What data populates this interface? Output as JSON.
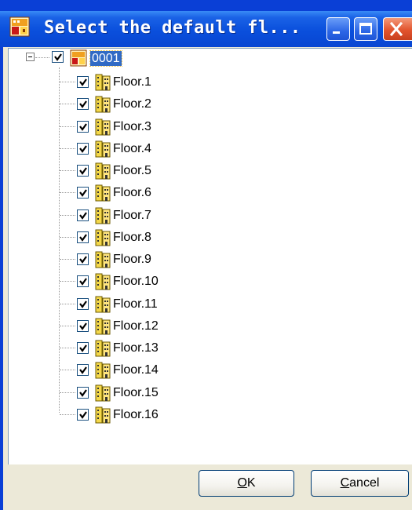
{
  "window": {
    "title": "Select the default fl...",
    "title_icon": "building-card-icon",
    "controls": [
      "minimize-icon",
      "maximize-icon",
      "close-icon"
    ]
  },
  "tree": {
    "root": {
      "label": "0001",
      "checked": true,
      "expanded": true,
      "selected": true,
      "icon": "building-card-icon"
    },
    "children": [
      {
        "label": "Floor.1",
        "checked": true,
        "icon": "floor-building-icon"
      },
      {
        "label": "Floor.2",
        "checked": true,
        "icon": "floor-building-icon"
      },
      {
        "label": "Floor.3",
        "checked": true,
        "icon": "floor-building-icon"
      },
      {
        "label": "Floor.4",
        "checked": true,
        "icon": "floor-building-icon"
      },
      {
        "label": "Floor.5",
        "checked": true,
        "icon": "floor-building-icon"
      },
      {
        "label": "Floor.6",
        "checked": true,
        "icon": "floor-building-icon"
      },
      {
        "label": "Floor.7",
        "checked": true,
        "icon": "floor-building-icon"
      },
      {
        "label": "Floor.8",
        "checked": true,
        "icon": "floor-building-icon"
      },
      {
        "label": "Floor.9",
        "checked": true,
        "icon": "floor-building-icon"
      },
      {
        "label": "Floor.10",
        "checked": true,
        "icon": "floor-building-icon"
      },
      {
        "label": "Floor.11",
        "checked": true,
        "icon": "floor-building-icon"
      },
      {
        "label": "Floor.12",
        "checked": true,
        "icon": "floor-building-icon"
      },
      {
        "label": "Floor.13",
        "checked": true,
        "icon": "floor-building-icon"
      },
      {
        "label": "Floor.14",
        "checked": true,
        "icon": "floor-building-icon"
      },
      {
        "label": "Floor.15",
        "checked": true,
        "icon": "floor-building-icon"
      },
      {
        "label": "Floor.16",
        "checked": true,
        "icon": "floor-building-icon"
      }
    ]
  },
  "buttons": {
    "ok": {
      "mnemonic": "O",
      "rest": "K"
    },
    "cancel": {
      "mnemonic": "C",
      "rest": "ancel"
    }
  }
}
